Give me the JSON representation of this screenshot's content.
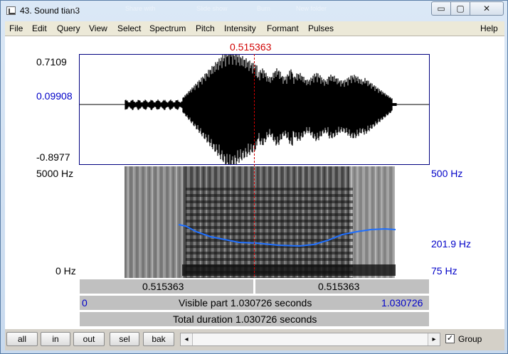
{
  "window": {
    "title": "43. Sound tian3",
    "ghost_menu": [
      "File",
      "Share with",
      "Slide show",
      "Burn",
      "New folder"
    ],
    "buttons": {
      "minimize": "▭",
      "maximize": "▢",
      "close": "✕"
    }
  },
  "menu": {
    "items": [
      "File",
      "Edit",
      "Query",
      "View",
      "Select",
      "Spectrum",
      "Pitch",
      "Intensity",
      "Formant",
      "Pulses"
    ],
    "help": "Help"
  },
  "cursor": {
    "time_label": "0.515363",
    "position_fraction": 0.5,
    "color": "#d00000"
  },
  "waveform": {
    "max_label": "0.7109",
    "cursor_value_label": "0.09908",
    "min_label": "-0.8977",
    "max_value": 0.7109,
    "min_value": -0.8977,
    "cursor_value": 0.09908
  },
  "spectrogram": {
    "freq_max_label": "5000 Hz",
    "freq_min_label": "0 Hz",
    "pitch_max_label": "500 Hz",
    "pitch_cursor_label": "201.9 Hz",
    "pitch_min_label": "75 Hz",
    "pitch_max": 500,
    "pitch_min": 75,
    "pitch_color": "#1e6fff"
  },
  "bars": {
    "left_duration": "0.515363",
    "right_duration": "0.515363",
    "visible_start": "0",
    "visible_text": "Visible part 1.030726 seconds",
    "visible_end": "1.030726",
    "total_text": "Total duration 1.030726 seconds"
  },
  "toolbar": {
    "buttons": [
      "all",
      "in",
      "out",
      "sel",
      "bak"
    ],
    "group_label": "Group",
    "group_checked": "✓",
    "scroll_left": "◂",
    "scroll_right": "▸"
  },
  "colors": {
    "label_blue": "#0000c8",
    "cursor_red": "#d00000",
    "pitch_blue": "#1e6fff"
  }
}
